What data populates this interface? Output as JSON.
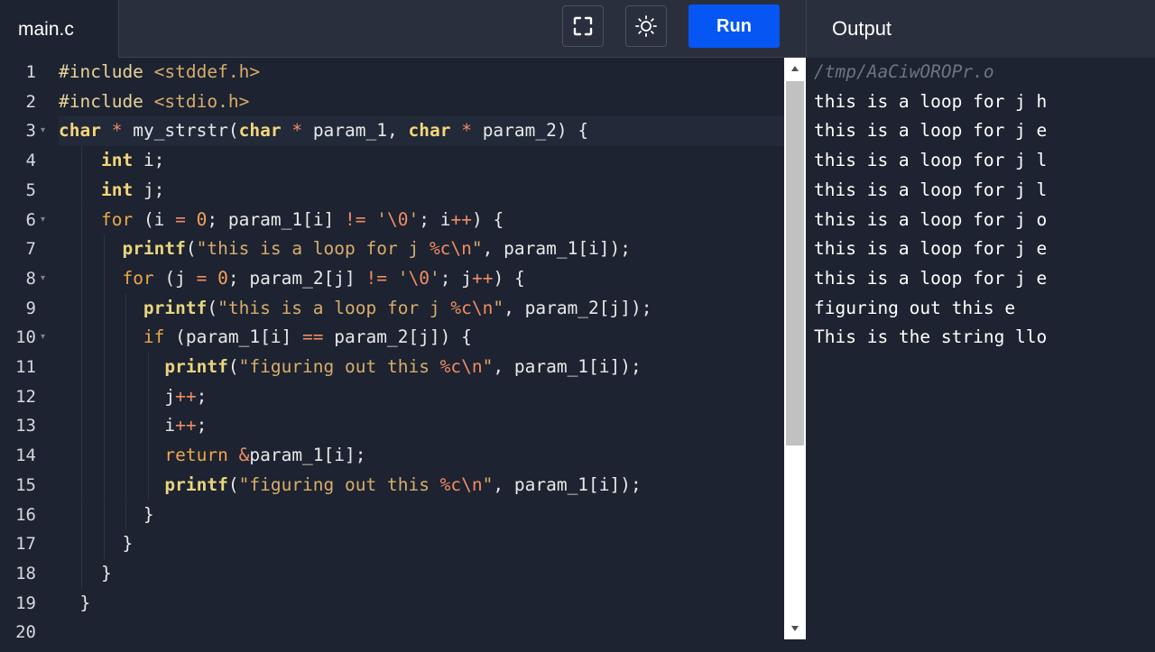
{
  "file_tab": "main.c",
  "toolbar": {
    "run_label": "Run",
    "fullscreen_icon": "fullscreen-icon",
    "theme_icon": "sun-icon"
  },
  "output": {
    "title": "Output",
    "path": "/tmp/AaCiwOROPr.o",
    "lines": [
      "this is a loop for j h",
      "this is a loop for j e",
      "this is a loop for j l",
      "this is a loop for j l",
      "this is a loop for j o",
      "this is a loop for j e",
      "this is a loop for j e",
      "figuring out this e",
      "This is the string llo"
    ]
  },
  "editor": {
    "active_line": 3,
    "fold_lines": [
      3,
      6,
      8,
      10
    ],
    "lines": [
      "#include <stddef.h>",
      "#include <stdio.h>",
      "char * my_strstr(char * param_1, char * param_2) {",
      "    int i;",
      "    int j;",
      "    for (i = 0; param_1[i] != '\\0'; i++) {",
      "      printf(\"this is a loop for j %c\\n\", param_1[i]);",
      "      for (j = 0; param_2[j] != '\\0'; j++) {",
      "        printf(\"this is a loop for j %c\\n\", param_2[j]);",
      "        if (param_1[i] == param_2[j]) {",
      "          printf(\"figuring out this %c\\n\", param_1[i]);",
      "          j++;",
      "          i++;",
      "          return &param_1[i];",
      "          printf(\"figuring out this %c\\n\", param_1[i]);",
      "        }",
      "      }",
      "    }",
      "  }",
      ""
    ]
  }
}
